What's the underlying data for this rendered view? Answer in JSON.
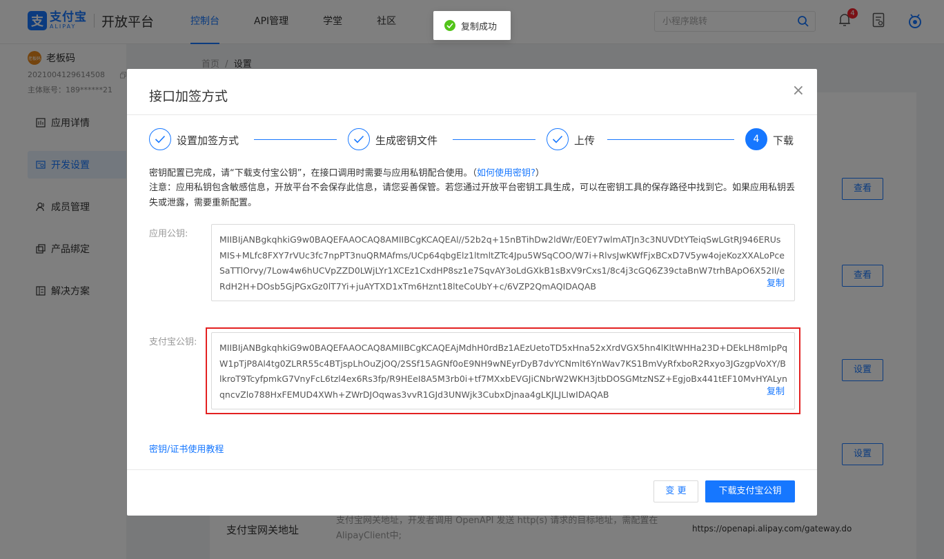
{
  "header": {
    "logo_cn": "支付宝",
    "logo_en": "ALIPAY",
    "platform": "开放平台",
    "nav": [
      "控制台",
      "API管理",
      "学堂",
      "社区"
    ],
    "search_placeholder": "小程序跳转",
    "notification_count": "4",
    "accent_color": "#1677ff"
  },
  "sidebar": {
    "avatar_text": "老板码",
    "user_name": "老板码",
    "user_id": "2021004129614508",
    "account": "主体账号：189******21",
    "items": [
      {
        "label": "应用详情",
        "icon": "app-detail-icon"
      },
      {
        "label": "开发设置",
        "icon": "dev-settings-icon"
      },
      {
        "label": "成员管理",
        "icon": "members-icon"
      },
      {
        "label": "产品绑定",
        "icon": "product-bind-icon"
      },
      {
        "label": "解决方案",
        "icon": "solution-icon"
      }
    ]
  },
  "breadcrumb": {
    "home": "首页",
    "sep": "/",
    "current": "设置"
  },
  "main": {
    "buttons": [
      "查看",
      "查看",
      "设置",
      "设置"
    ],
    "gateway_title": "支付宝网关地址",
    "gateway_desc": "支付宝网关地址，开发者调用 OpenAPI 发送 http(s) 请求的目标地址，需配置在AlipayClient中;",
    "gateway_url": "https://openapi.alipay.com/gateway.do"
  },
  "modal": {
    "title": "接口加签方式",
    "close": "×",
    "steps": [
      {
        "label": "设置加签方式",
        "state": "done"
      },
      {
        "label": "生成密钥文件",
        "state": "done"
      },
      {
        "label": "上传",
        "state": "done"
      },
      {
        "label": "下载",
        "state": "current",
        "number": "4"
      }
    ],
    "info_line1_prefix": "密钥配置已完成，请“下载支付宝公钥”，在接口调用时需要与应用私钥配合使用。（",
    "info_line1_link": "如何使用密钥?",
    "info_line1_suffix": "）",
    "info_line2": "注意：应用私钥包含敏感信息，开放平台不会保存此信息，请您妥善保管。若您通过开放平台密钥工具生成，可以在密钥工具的保存路径中找到它。如果应用私钥丢失或泄露，需要重新配置。",
    "app_key_label": "应用公钥:",
    "app_key": "MIIBIjANBgkqhkiG9w0BAQEFAAOCAQ8AMIIBCgKCAQEAl//52b2q+15nBTihDw2ldWr/E0EY7wlmATJn3c3NUVDtYTeiqSwLGtRJ946ERUsMIS+MLfc8FXY7rVUc3fc7npPT3nuQRMAfms/UCp64qbgElz1ltmltZTc4Jpu5WSqCOO/W7i+RlvsJwKWfFjxBCxD7V5yw4ojeKozXXALoPceSaTTlOrvy/7Low4w6hUCVpZZD0LWjLYr1XCEz1CxdHP8sz1e7SqvAY3oLdGXkB1sBxV9rCxs1/8c4j3cGQ6Z39ctaBnW7trhBApO6X52Il/eRdH2H+DOsb5GjPGxGz0lT7Yi+juAYTXD1xTm6Hznt18lteCoUbY+c/6VZP2QmAQIDAQAB",
    "alipay_key_label": "支付宝公钥:",
    "alipay_key": "MIIBIjANBgkqhkiG9w0BAQEFAAOCAQ8AMIIBCgKCAQEAjMdhH0rdBz1AEzUetoTD5xHna52xXrdVGX5hn4lKltWHHa23D+DEkLH8mIpPqW1pTjP8Al4tg0ZLRR55c4BTjspLhOuZjOQ/2SSf15AGNf0oE9NH9wNEyrDyB7dvYCNmlt6YnWav7KS1BmVyRfxboR2Rxyo3JGzgpVoXY/BlkroT9TcyfpmkG7VnyFcL6tzl4ex6Rs3fp/R9HEeI8A5M3rb0i+tf7MXxbEVGJiCNbrW2WKH3jtbDOSGMtzNSZ+EgjoBx441tEF10MvHYALynqncvZlo788HxFEMUD4XWh+ZWrDJOqwas3vvR1GJd3UNWjk3CubxDjnaa4gLKJLJLIwIDAQAB",
    "copy_label": "复制",
    "tutorial_link": "密钥/证书使用教程",
    "btn_change": "变 更",
    "btn_download": "下载支付宝公钥"
  },
  "toast": {
    "text": "复制成功",
    "status_color": "#52c41a"
  }
}
